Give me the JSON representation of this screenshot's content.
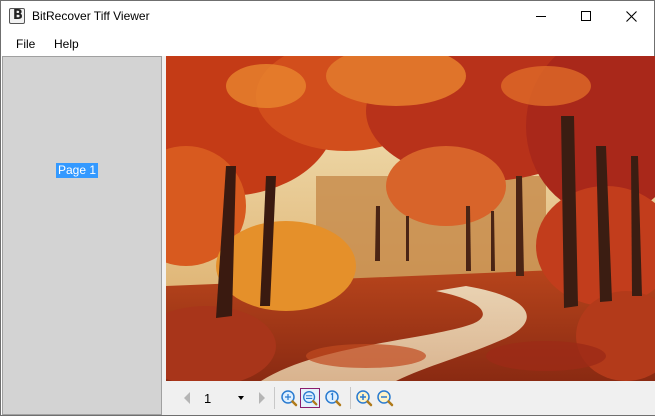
{
  "window": {
    "title": "BitRecover Tiff Viewer",
    "app_icon_letter": "B"
  },
  "menu": {
    "items": [
      {
        "label": "File"
      },
      {
        "label": "Help"
      }
    ]
  },
  "sidebar": {
    "pages": [
      {
        "label": "Page 1",
        "selected": true
      }
    ]
  },
  "viewer": {
    "image": "autumn-forest-path",
    "description_colors": {
      "sky": "#f3e2b0",
      "foliage": "#c9431a",
      "path": "#e6c9a6"
    }
  },
  "toolbar": {
    "current_page": "1",
    "buttons": [
      {
        "icon": "previous-page-icon"
      },
      {
        "icon": "next-page-icon"
      },
      {
        "icon": "fit-page-icon"
      },
      {
        "icon": "fit-width-icon",
        "active": true
      },
      {
        "icon": "actual-size-icon"
      },
      {
        "icon": "zoom-in-icon"
      },
      {
        "icon": "zoom-out-icon"
      }
    ]
  },
  "colors": {
    "selection": "#3399ff",
    "sidebar_bg": "#d3d3d3",
    "toolbar_bg": "#f0f0f0",
    "active_border": "#8b1e6e"
  }
}
